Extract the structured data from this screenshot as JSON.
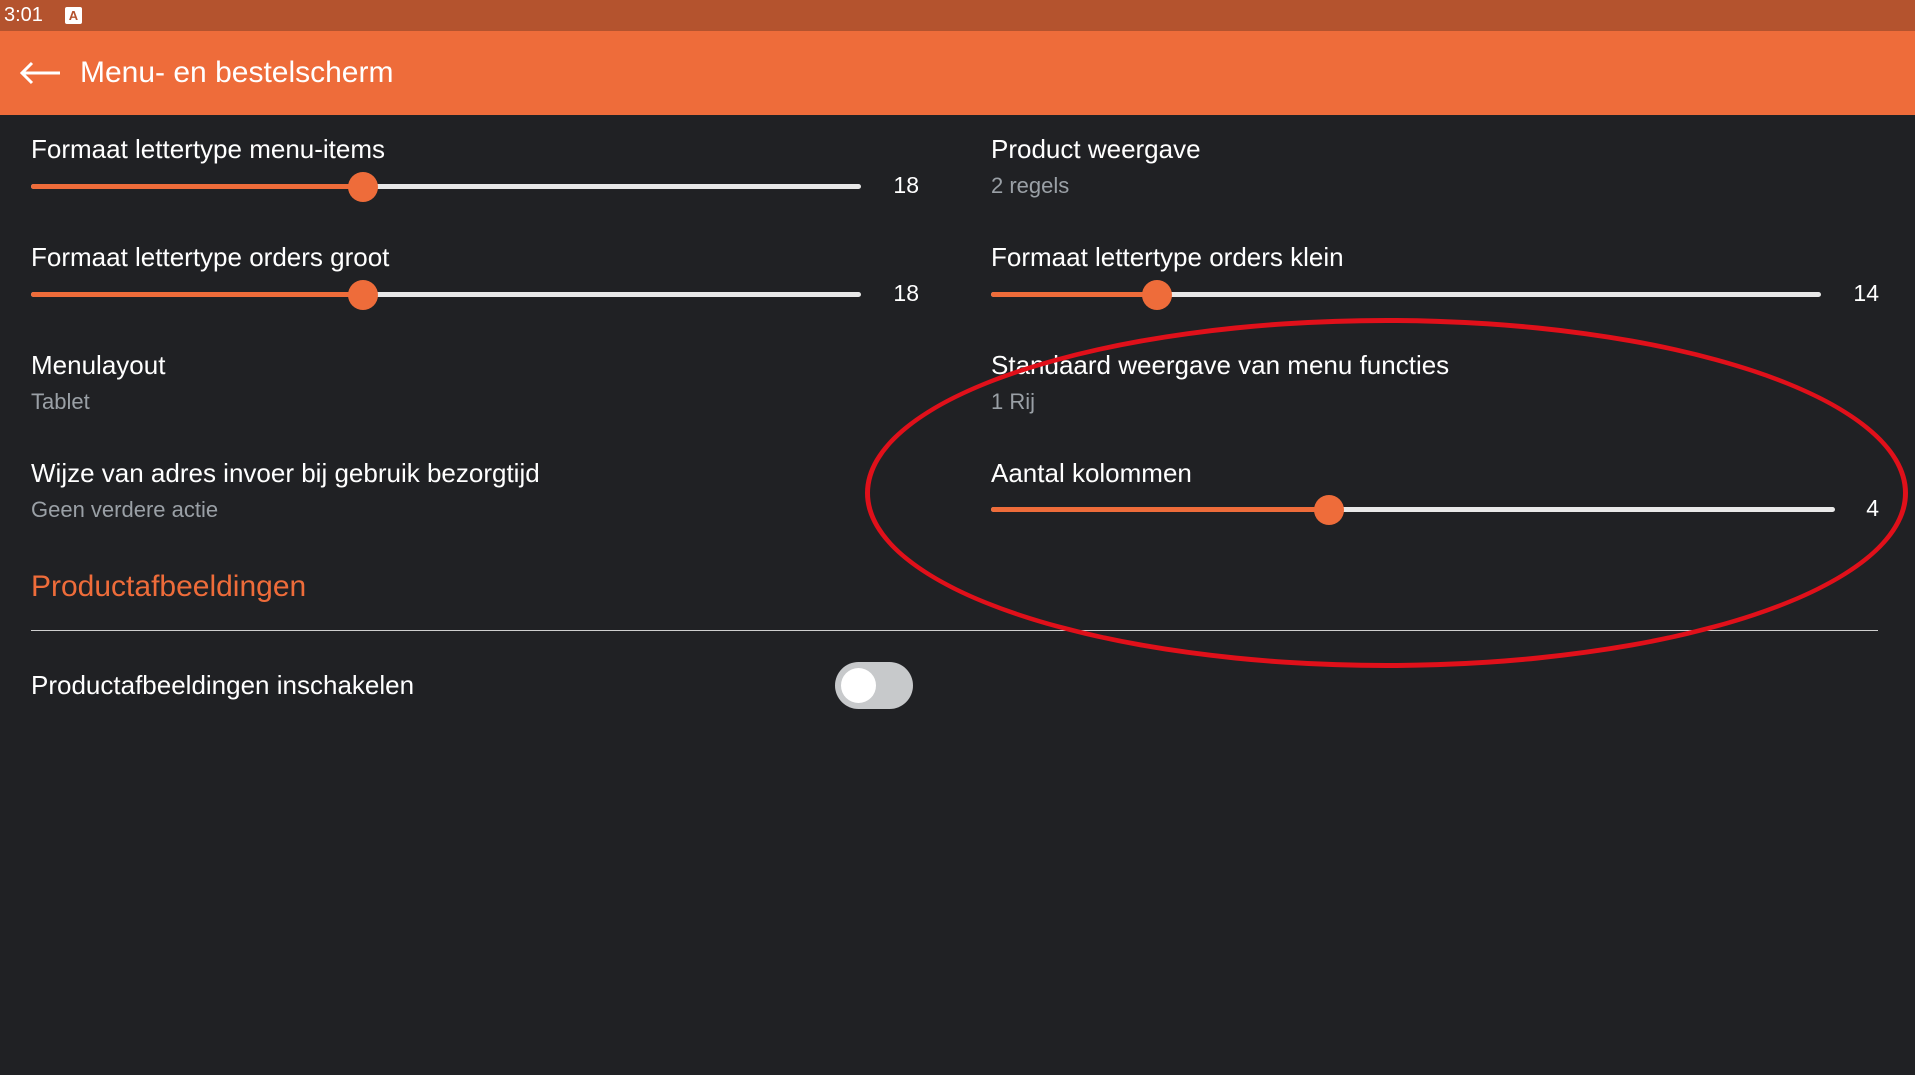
{
  "statusbar": {
    "time": "3:01",
    "notification_icon": "A"
  },
  "appbar": {
    "title": "Menu- en bestelscherm",
    "back_icon": "arrow-left-icon"
  },
  "colors": {
    "accent": "#ee6c3a",
    "statusbar": "#b4532e",
    "background": "#202124",
    "annotation": "#e0101a"
  },
  "left": {
    "font_menu_items": {
      "label": "Formaat lettertype menu-items",
      "value": "18",
      "fraction": 0.4
    },
    "font_orders_large": {
      "label": "Formaat lettertype orders groot",
      "value": "18",
      "fraction": 0.4
    },
    "menulayout": {
      "label": "Menulayout",
      "summary": "Tablet"
    },
    "address_input": {
      "label": "Wijze van adres invoer bij gebruik bezorgtijd",
      "summary": "Geen verdere actie"
    }
  },
  "right": {
    "product_display": {
      "label": "Product weergave",
      "summary": "2 regels"
    },
    "font_orders_small": {
      "label": "Formaat lettertype orders klein",
      "value": "14",
      "fraction": 0.2
    },
    "default_menu_functions": {
      "label": "Standaard weergave van menu functies",
      "summary": "1 Rij"
    },
    "columns": {
      "label": "Aantal kolommen",
      "value": "4",
      "fraction": 0.4
    }
  },
  "section": {
    "title": "Productafbeeldingen",
    "enable_images": {
      "label": "Productafbeeldingen inschakelen",
      "checked": false
    }
  }
}
